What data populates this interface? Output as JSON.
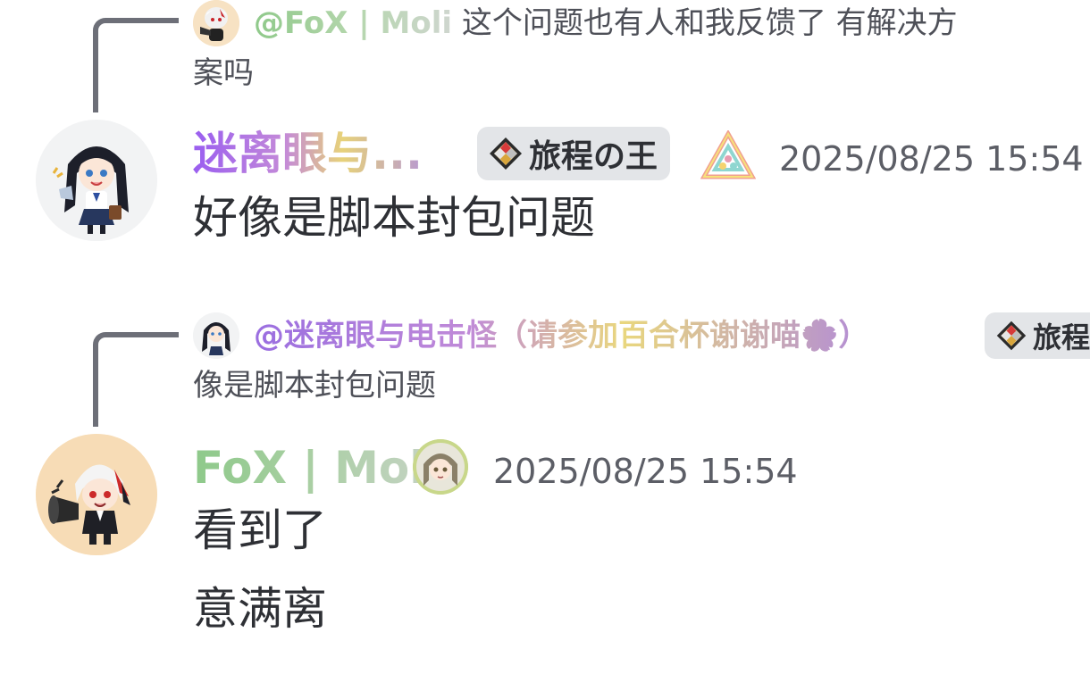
{
  "messages": [
    {
      "reply": {
        "mention": "@FoX | Moli",
        "text_line1": "这个问题也有人和我反馈了 有解决方",
        "text_line2": "案吗"
      },
      "author": "迷离眼与...",
      "role_tag": "旅程の王",
      "timestamp": "2025/08/25 15:54",
      "lines": [
        "好像是脚本封包问题"
      ]
    },
    {
      "reply": {
        "mention": "@迷离眼与电击怪（请参加百合杯谢谢喵🌸）",
        "role_tag": "旅程",
        "text_line2": "像是脚本封包问题"
      },
      "author": "FoX | Moli",
      "timestamp": "2025/08/25 15:54",
      "lines": [
        "看到了",
        "意满离"
      ]
    }
  ],
  "colors": {
    "background": "#ffffff",
    "reply_line": "#6d6f78",
    "tag_bg": "#e3e5e8",
    "text": "#2e3035",
    "muted": "#5c5e66"
  }
}
